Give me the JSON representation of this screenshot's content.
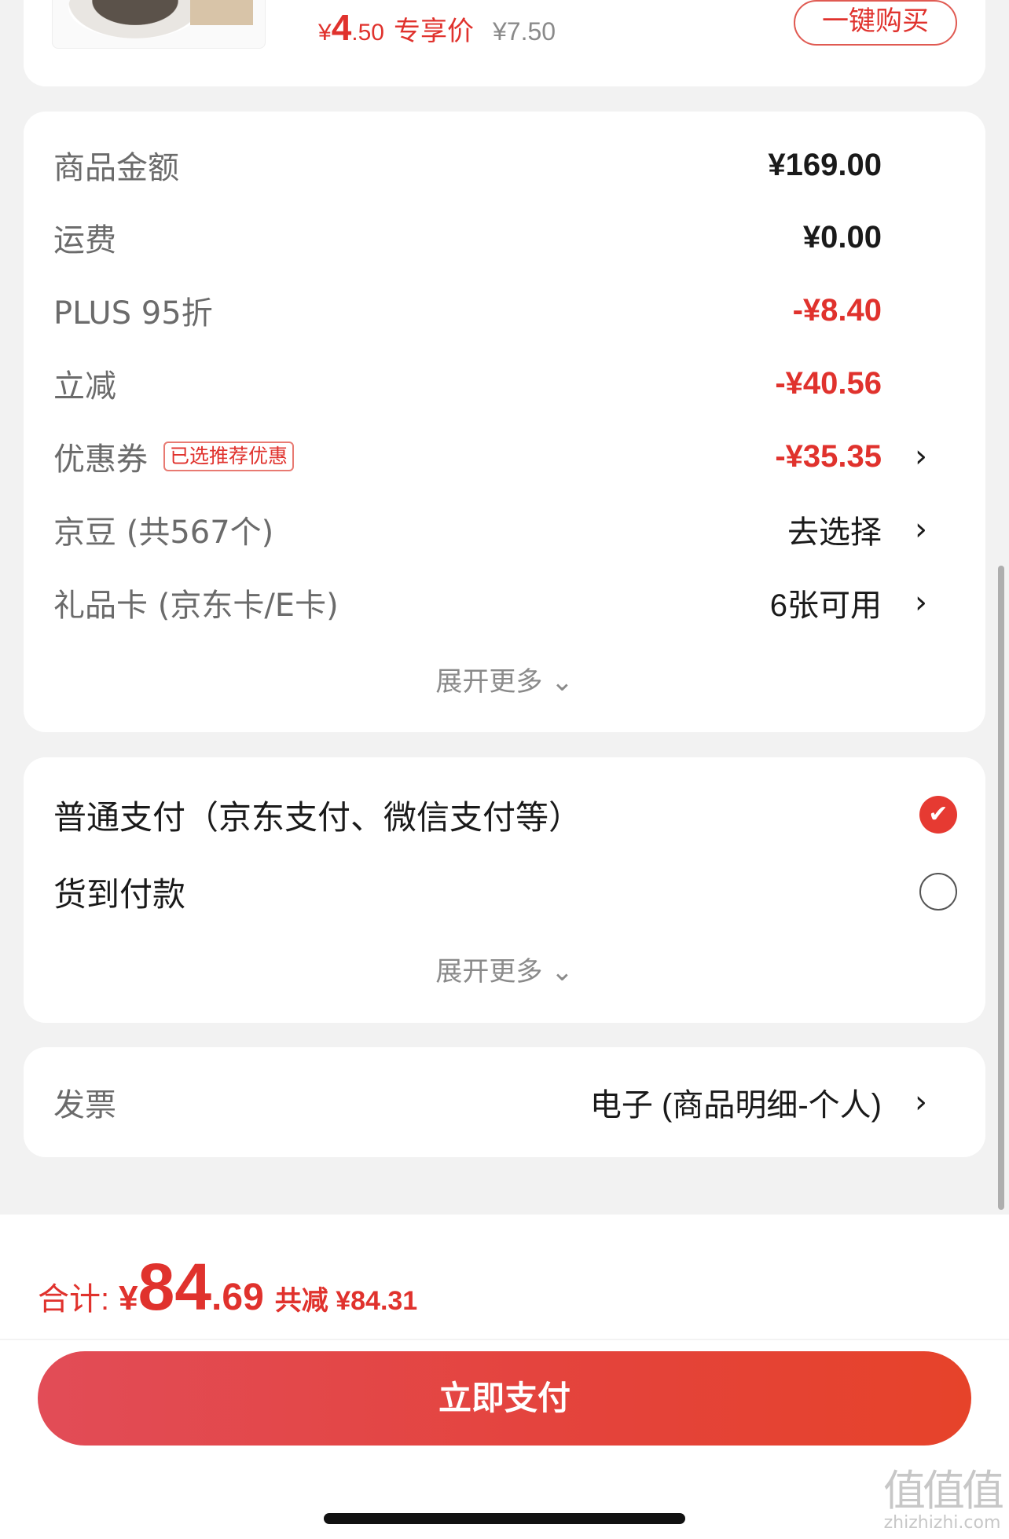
{
  "top_product": {
    "currency": "¥",
    "price_int": "4",
    "price_dec": ".50",
    "price_tag": "专享价",
    "original_price": "¥7.50",
    "buy_button": "一键购买"
  },
  "summary": {
    "rows": [
      {
        "label": "商品金额",
        "value": "¥169.00"
      },
      {
        "label": "运费",
        "value": "¥0.00"
      },
      {
        "label": "PLUS 95折",
        "value": "-¥8.40"
      },
      {
        "label": "立减",
        "value": "-¥40.56"
      },
      {
        "label": "优惠券",
        "badge": "已选推荐优惠",
        "value": "-¥35.35",
        "chevron": "›"
      },
      {
        "label": "京豆 (共567个)",
        "value": "去选择",
        "chevron": "›"
      },
      {
        "label": "礼品卡 (京东卡/E卡)",
        "value": "6张可用",
        "chevron": "›"
      }
    ],
    "expand_more": "展开更多 ⌄"
  },
  "payment": {
    "options": [
      {
        "label": "普通支付（京东支付、微信支付等）",
        "selected": true,
        "check": "✔"
      },
      {
        "label": "货到付款",
        "selected": false
      }
    ],
    "expand_more": "展开更多 ⌄"
  },
  "invoice": {
    "label": "发票",
    "value": "电子 (商品明细-个人)",
    "chevron": "›"
  },
  "footer": {
    "total_label": "合计:",
    "currency": "¥",
    "total_int": "84",
    "total_dec": ".69",
    "savings": "共减 ¥84.31",
    "pay_button": "立即支付"
  },
  "watermark": {
    "mark": "值值值",
    "site": "zhizhizhi.com"
  },
  "colors": {
    "accent_red": "#e0322d",
    "page_bg": "#f2f2f2",
    "card_bg": "#ffffff"
  }
}
